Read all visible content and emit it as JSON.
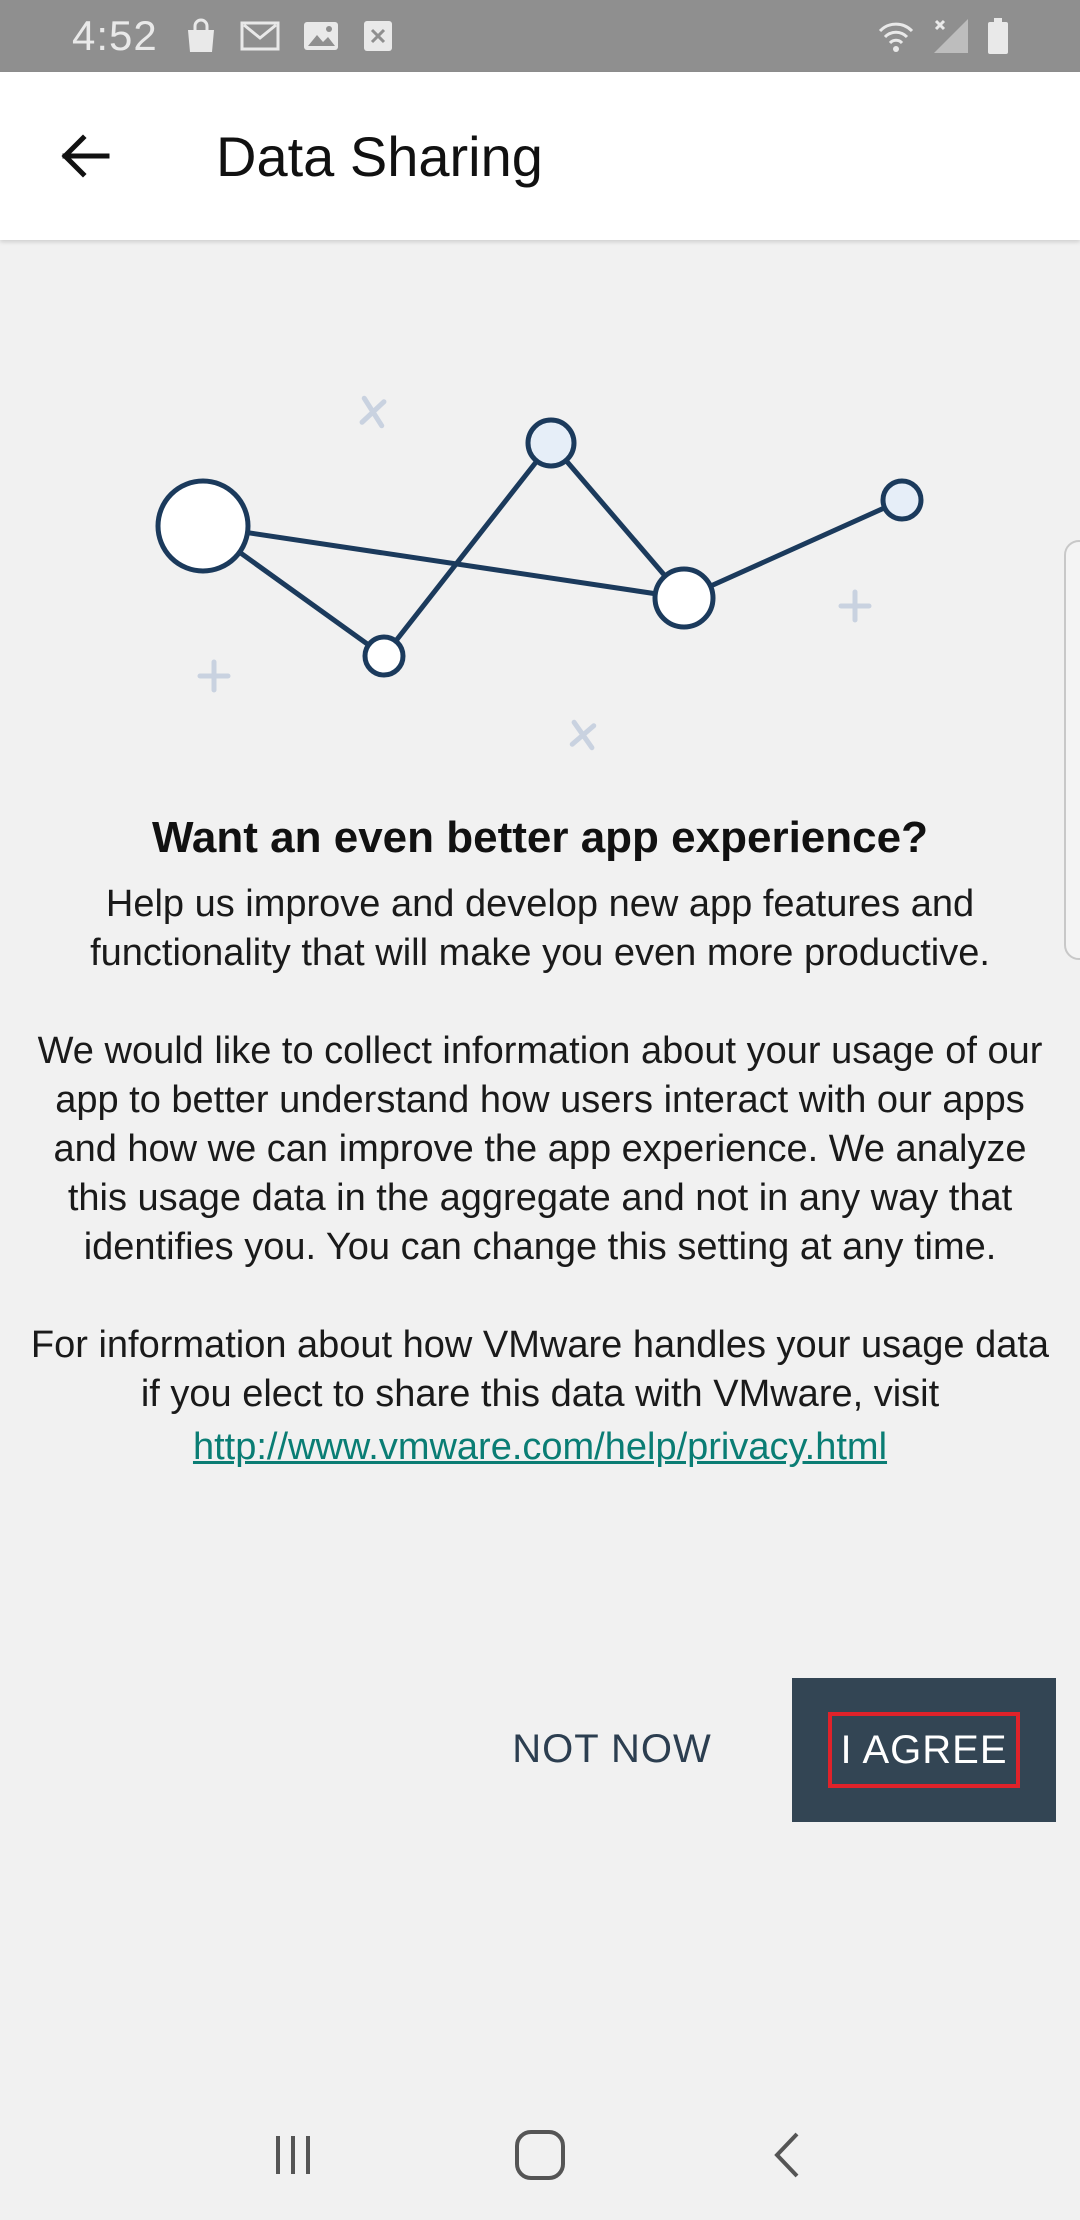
{
  "status_bar": {
    "time": "4:52",
    "left_icons": [
      "shopping-bag-icon",
      "gmail-icon",
      "image-icon",
      "close-box-icon"
    ],
    "right_icons": [
      "wifi-icon",
      "no-signal-icon",
      "battery-icon"
    ]
  },
  "app_bar": {
    "title": "Data Sharing",
    "back_icon": "arrow-left-icon"
  },
  "content": {
    "headline": "Want an even better app experience?",
    "paragraph1": "Help us improve and develop new app features and functionality that will make you even more productive.",
    "paragraph2": "We would like to collect information about your usage of our app to better understand how users interact with our apps and how we can improve the app experience. We analyze this usage data in the aggregate and not in any way that identifies you. You can change this setting at any time.",
    "paragraph3": "For information about how VMware handles your usage data if you elect to share this data with VMware, visit",
    "link": "http://www.vmware.com/help/privacy.html"
  },
  "actions": {
    "not_now_label": "NOT NOW",
    "agree_label": "I AGREE"
  },
  "colors": {
    "status_bar": "#8f8f8f",
    "primary_dark": "#334554",
    "link": "#0a7d74",
    "highlight": "#e0222a",
    "illustration_stroke": "#1b3a5c"
  },
  "nav_bar": {
    "icons": [
      "recent-apps-icon",
      "home-icon",
      "back-icon"
    ]
  }
}
